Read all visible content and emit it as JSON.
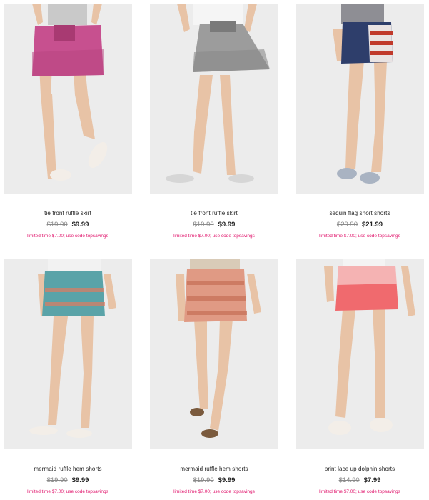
{
  "colors": {
    "promo": "#e0126a",
    "photo_bg": "#ececec",
    "old_price": "#8a8a8a"
  },
  "products": [
    {
      "name": "tie front ruffle skirt",
      "original_price": "$19.90",
      "sale_price": "$9.99",
      "promo": "limited time $7.00; use code topsavings",
      "garment_color": "#c7508f"
    },
    {
      "name": "tie front ruffle skirt",
      "original_price": "$19.90",
      "sale_price": "$9.99",
      "promo": "limited time $7.00; use code topsavings",
      "garment_color": "#9c9c9c"
    },
    {
      "name": "sequin flag short shorts",
      "original_price": "$29.90",
      "sale_price": "$21.99",
      "promo": "limited time $7.00; use code topsavings",
      "garment_color": "#2e3e6b"
    },
    {
      "name": "mermaid ruffle hem shorts",
      "original_price": "$19.90",
      "sale_price": "$9.99",
      "promo": "limited time $7.00; use code topsavings",
      "garment_color": "#5aa3a8"
    },
    {
      "name": "mermaid ruffle hem shorts",
      "original_price": "$19.90",
      "sale_price": "$9.99",
      "promo": "limited time $7.00; use code topsavings",
      "garment_color": "#e09a84"
    },
    {
      "name": "print lace up dolphin shorts",
      "original_price": "$14.90",
      "sale_price": "$7.99",
      "promo": "limited time $7.00; use code topsavings",
      "garment_color": "#f06a6e"
    }
  ]
}
